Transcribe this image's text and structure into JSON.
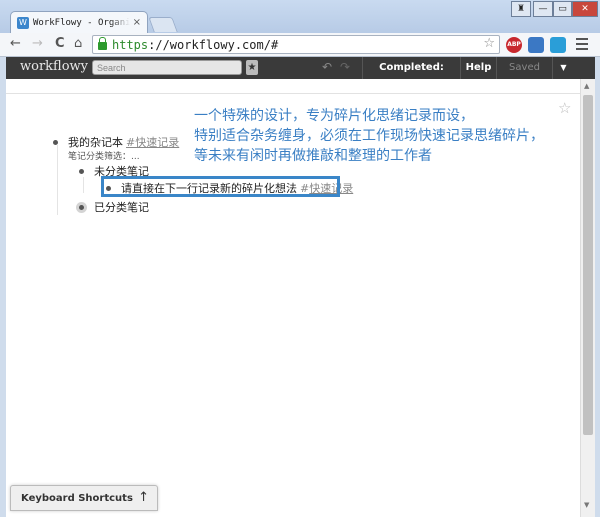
{
  "browser": {
    "tab_title": "WorkFlowy - Organize yo",
    "tab_favicon": "W",
    "tab_close": "×",
    "url_scheme": "https",
    "url_rest": "://workflowy.com/#",
    "controls": {
      "user": "♜",
      "minimize": "—",
      "maximize": "▭",
      "close": "✕"
    },
    "nav": {
      "back": "←",
      "forward": "→",
      "reload": "C",
      "home": "⌂"
    },
    "bookmark_star": "☆",
    "extensions": [
      "ABP",
      "",
      ""
    ]
  },
  "app": {
    "logo": "workflowy",
    "search_placeholder": "Search",
    "star_button": "★",
    "undo": "↶",
    "redo": "↷",
    "completed_button": "Completed: Visible",
    "help_button": "Help",
    "saved_button": "Saved",
    "dropdown_button": "▼"
  },
  "outline": {
    "root": {
      "text": "我的杂记本",
      "tag": "#快速记录",
      "note": "笔记分类筛选：..."
    },
    "child1": {
      "text": "未分类笔记"
    },
    "grandchild1": {
      "text": "请直接在下一行记录新的碎片化想法",
      "tag_prefix": "#",
      "tag": "快速记录"
    },
    "child2": {
      "text": "已分类笔记"
    }
  },
  "annotation": {
    "line1": "一个特殊的设计，专为碎片化思绪记录而设，",
    "line2": "特别适合杂务缠身，必须在工作现场快速记录思绪碎片，",
    "line3": "等未来有闲时再做推敲和整理的工作者"
  },
  "page_star": "☆",
  "keyboard_shortcuts": {
    "label": "Keyboard Shortcuts",
    "arrow": "↑"
  },
  "colors": {
    "highlight_border": "#3a86c8",
    "annotation": "#3a7fc4",
    "header_bg": "#3a3a3a"
  }
}
